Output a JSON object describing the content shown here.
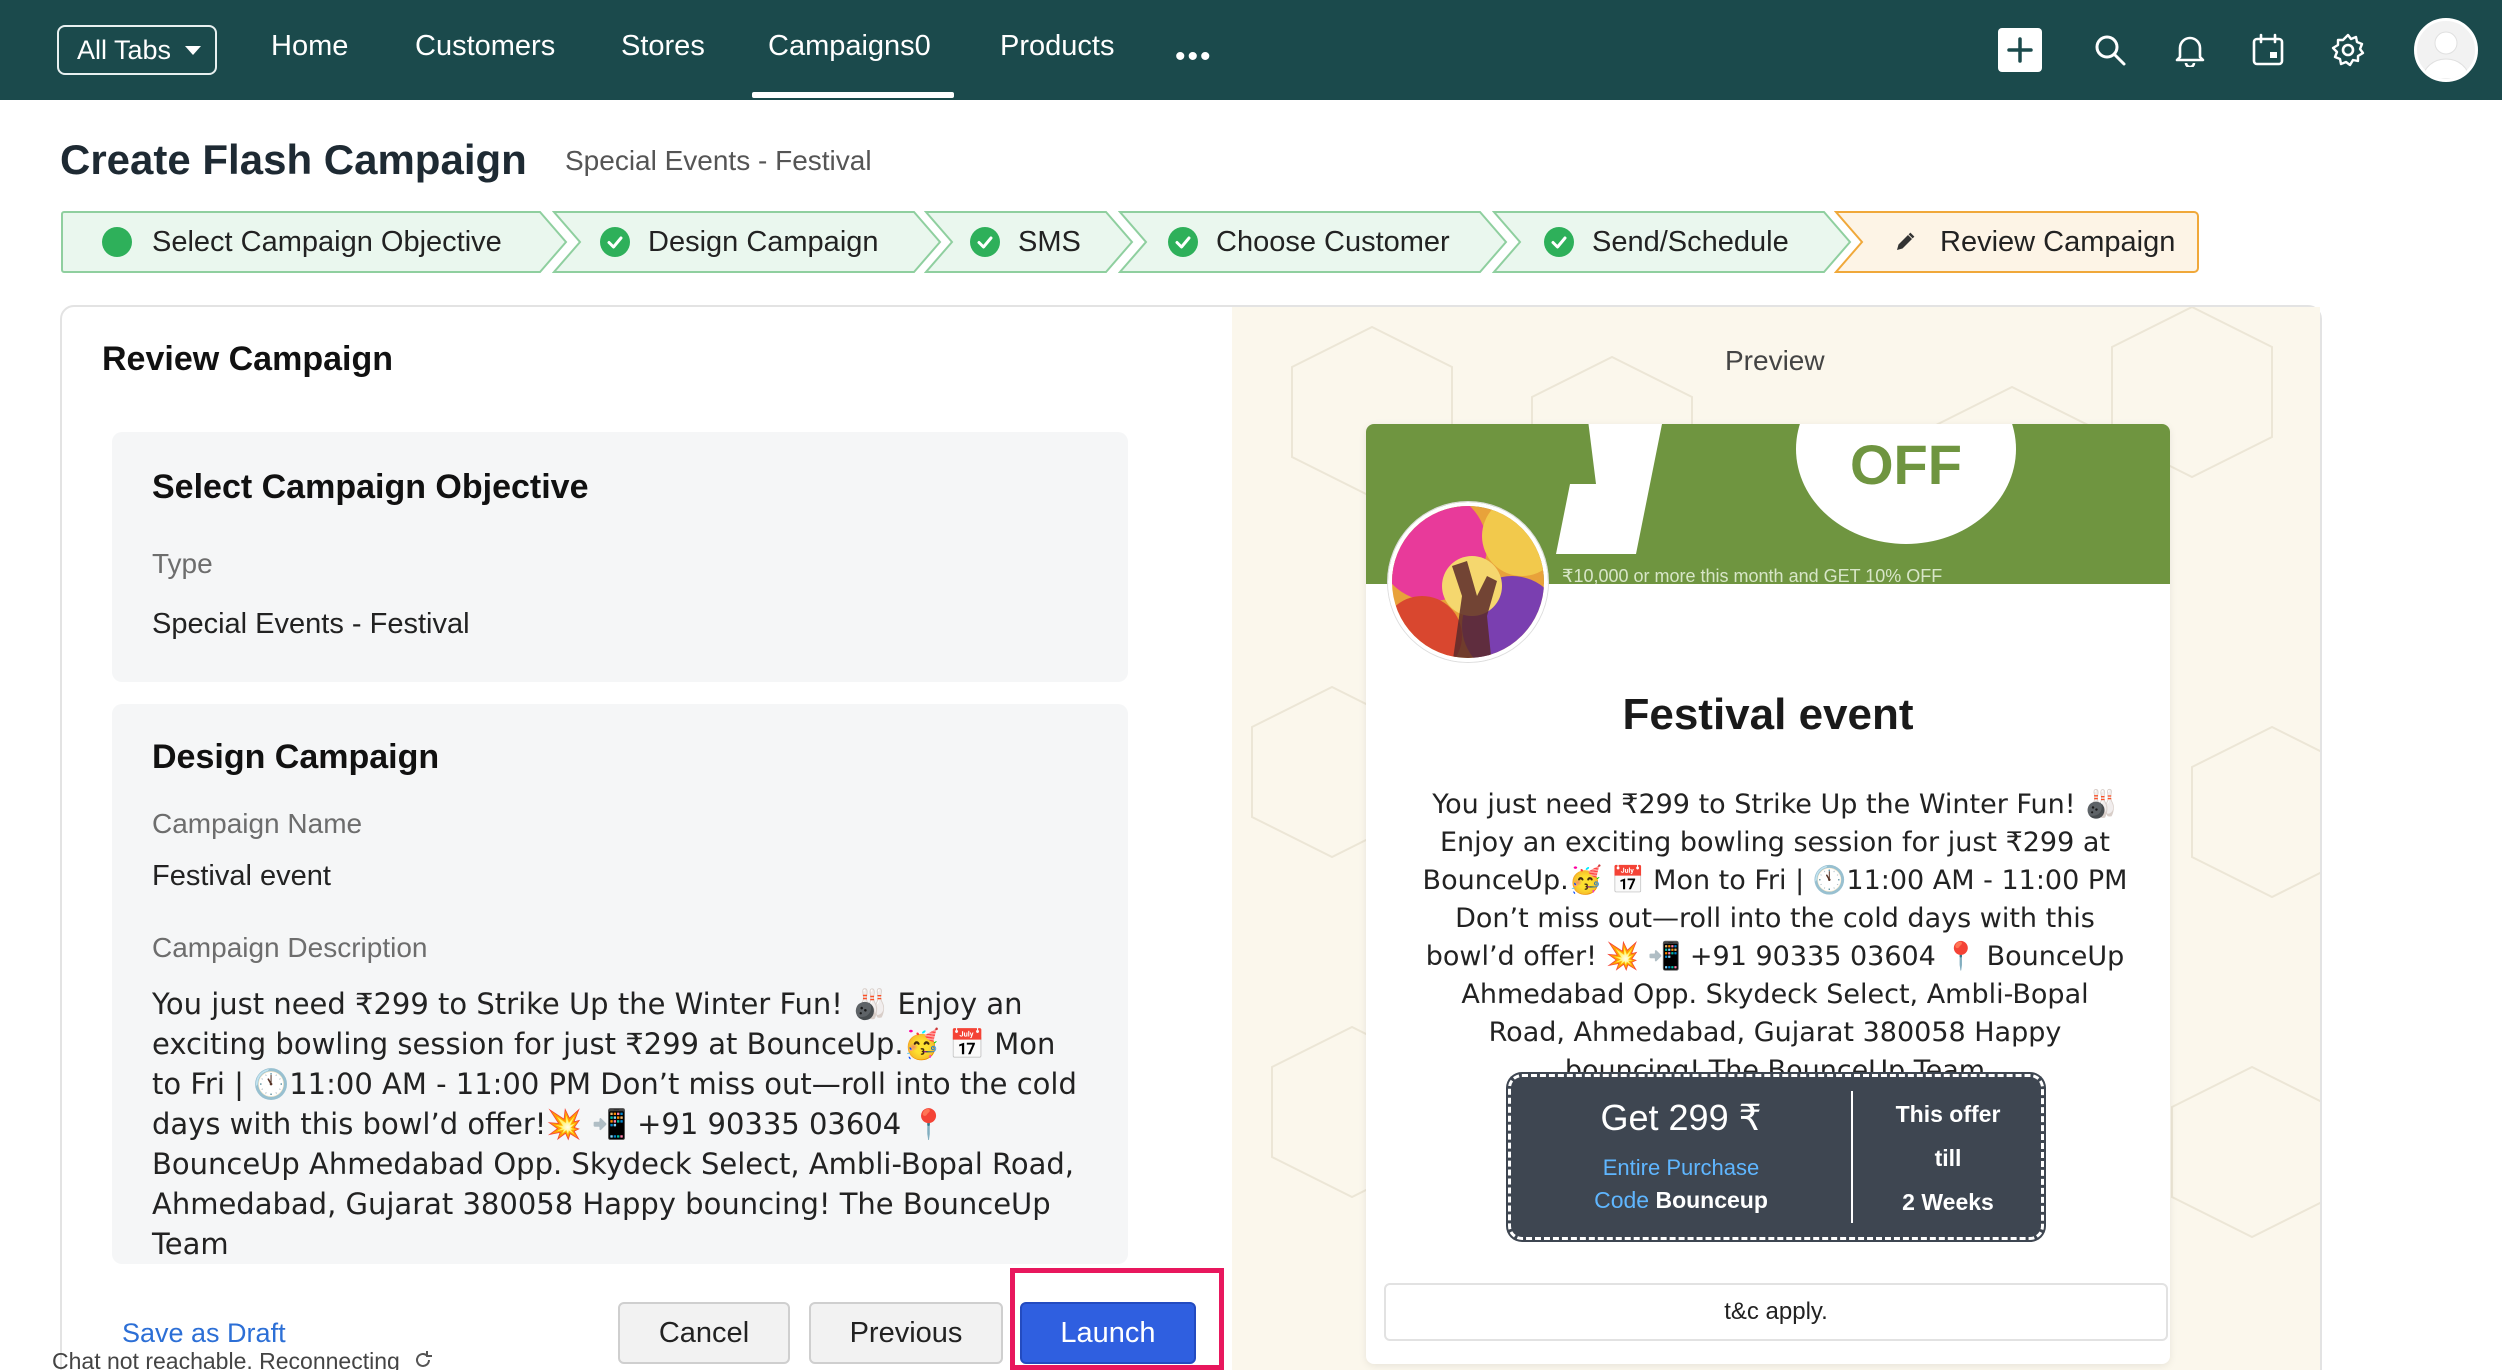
{
  "nav": {
    "all_tabs": "All Tabs",
    "items": [
      "Home",
      "Customers",
      "Stores",
      "Campaigns0",
      "Products"
    ],
    "active": "Campaigns0",
    "more": "•••"
  },
  "header": {
    "title": "Create Flash Campaign",
    "subtitle": "Special Events - Festival"
  },
  "steps": [
    {
      "label": "Select Campaign Objective",
      "status": "current-dot"
    },
    {
      "label": "Design Campaign",
      "status": "done"
    },
    {
      "label": "SMS",
      "status": "done"
    },
    {
      "label": "Choose Customer",
      "status": "done"
    },
    {
      "label": "Send/Schedule",
      "status": "done"
    },
    {
      "label": "Review Campaign",
      "status": "editing"
    }
  ],
  "review": {
    "title": "Review Campaign",
    "objective": {
      "title": "Select Campaign Objective",
      "type_label": "Type",
      "type_value": "Special Events - Festival"
    },
    "design": {
      "title": "Design Campaign",
      "name_label": "Campaign Name",
      "name_value": "Festival event",
      "desc_label": "Campaign Description",
      "desc_value": "You just need ₹299 to Strike Up the Winter Fun! 🎳 Enjoy an exciting bowling session for just ₹299 at BounceUp.🥳 📅 Mon to Fri | 🕚11:00 AM - 11:00 PM Don’t miss out—roll into the cold days with this bowl’d offer!💥 📲 +91 90335 03604 📍 BounceUp Ahmedabad Opp. Skydeck Select, Ambli-Bopal Road, Ahmedabad, Gujarat 380058 Happy bouncing! The BounceUp Team"
    }
  },
  "actions": {
    "save_draft": "Save as Draft",
    "cancel": "Cancel",
    "previous": "Previous",
    "launch": "Launch"
  },
  "status": "Chat not reachable. Reconnecting",
  "preview": {
    "label": "Preview",
    "banner_pct": "%",
    "banner_off": "OFF",
    "banner_fine": "₹10,000 or more this month and GET 10% OFF",
    "title": "Festival event",
    "description": "You just need ₹299 to Strike Up the Winter Fun! 🎳 Enjoy an exciting bowling session for just ₹299 at BounceUp.🥳 📅 Mon to Fri | 🕚11:00 AM - 11:00 PM Don’t miss out—roll into the cold days with this bowl’d offer! 💥 📲 +91 90335 03604 📍 BounceUp Ahmedabad Opp. Skydeck Select, Ambli-Bopal Road, Ahmedabad, Gujarat 380058 Happy bouncing! The BounceUp Team",
    "coupon": {
      "get": "Get 299 ₹",
      "entire": "Entire Purchase",
      "code_label": "Code",
      "code_value": "Bounceup",
      "offer_line1": "This offer",
      "offer_line2": "till",
      "offer_line3": "2 Weeks"
    },
    "tc": "t&c apply."
  },
  "colors": {
    "topbar": "#1b4a4c",
    "step_done": "#2eb05a",
    "step_active_border": "#f0a83a",
    "launch": "#2f5fe0",
    "highlight": "#e8175d",
    "banner": "#6f9540",
    "coupon": "#3e4651"
  },
  "icons": [
    "plus-icon",
    "search-icon",
    "bell-icon",
    "calendar-icon",
    "gear-icon",
    "avatar-icon",
    "pencil-icon",
    "check-icon",
    "refresh-icon"
  ]
}
